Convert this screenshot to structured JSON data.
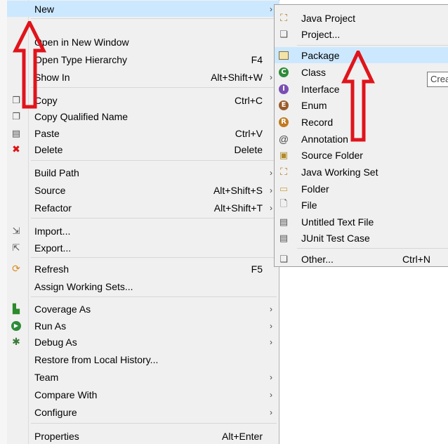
{
  "main_menu": {
    "items": [
      {
        "label": "New",
        "accel": "",
        "submenu": true,
        "selected": true,
        "icon": ""
      },
      {
        "label": "Open in New Window",
        "accel": "",
        "submenu": false,
        "icon": ""
      },
      {
        "label": "Open Type Hierarchy",
        "accel": "F4",
        "submenu": false,
        "icon": ""
      },
      {
        "label": "Show In",
        "accel": "Alt+Shift+W",
        "submenu": true,
        "icon": ""
      },
      {
        "label": "Copy",
        "accel": "Ctrl+C",
        "submenu": false,
        "icon": "copy-icon"
      },
      {
        "label": "Copy Qualified Name",
        "accel": "",
        "submenu": false,
        "icon": "copy-qualified-name-icon"
      },
      {
        "label": "Paste",
        "accel": "Ctrl+V",
        "submenu": false,
        "icon": "paste-icon"
      },
      {
        "label": "Delete",
        "accel": "Delete",
        "submenu": false,
        "icon": "delete-icon"
      },
      {
        "label": "Build Path",
        "accel": "",
        "submenu": true,
        "icon": ""
      },
      {
        "label": "Source",
        "accel": "Alt+Shift+S",
        "submenu": true,
        "icon": ""
      },
      {
        "label": "Refactor",
        "accel": "Alt+Shift+T",
        "submenu": true,
        "icon": ""
      },
      {
        "label": "Import...",
        "accel": "",
        "submenu": false,
        "icon": "import-icon"
      },
      {
        "label": "Export...",
        "accel": "",
        "submenu": false,
        "icon": "export-icon"
      },
      {
        "label": "Refresh",
        "accel": "F5",
        "submenu": false,
        "icon": "refresh-icon"
      },
      {
        "label": "Assign Working Sets...",
        "accel": "",
        "submenu": false,
        "icon": ""
      },
      {
        "label": "Coverage As",
        "accel": "",
        "submenu": true,
        "icon": "coverage-icon"
      },
      {
        "label": "Run As",
        "accel": "",
        "submenu": true,
        "icon": "run-icon"
      },
      {
        "label": "Debug As",
        "accel": "",
        "submenu": true,
        "icon": "debug-icon"
      },
      {
        "label": "Restore from Local History...",
        "accel": "",
        "submenu": false,
        "icon": ""
      },
      {
        "label": "Team",
        "accel": "",
        "submenu": true,
        "icon": ""
      },
      {
        "label": "Compare With",
        "accel": "",
        "submenu": true,
        "icon": ""
      },
      {
        "label": "Configure",
        "accel": "",
        "submenu": true,
        "icon": ""
      },
      {
        "label": "Properties",
        "accel": "Alt+Enter",
        "submenu": false,
        "icon": ""
      }
    ]
  },
  "submenu": {
    "items": [
      {
        "label": "Java Project",
        "accel": "",
        "icon": "java-project-icon"
      },
      {
        "label": "Project...",
        "accel": "",
        "icon": "project-icon"
      },
      {
        "label": "Package",
        "accel": "",
        "icon": "package-icon",
        "selected": true
      },
      {
        "label": "Class",
        "accel": "",
        "icon": "class-icon"
      },
      {
        "label": "Interface",
        "accel": "",
        "icon": "interface-icon"
      },
      {
        "label": "Enum",
        "accel": "",
        "icon": "enum-icon"
      },
      {
        "label": "Record",
        "accel": "",
        "icon": "record-icon"
      },
      {
        "label": "Annotation",
        "accel": "",
        "icon": "annotation-icon"
      },
      {
        "label": "Source Folder",
        "accel": "",
        "icon": "source-folder-icon"
      },
      {
        "label": "Java Working Set",
        "accel": "",
        "icon": "java-working-set-icon"
      },
      {
        "label": "Folder",
        "accel": "",
        "icon": "folder-icon"
      },
      {
        "label": "File",
        "accel": "",
        "icon": "file-icon"
      },
      {
        "label": "Untitled Text File",
        "accel": "",
        "icon": "untitled-text-file-icon"
      },
      {
        "label": "JUnit Test Case",
        "accel": "",
        "icon": "junit-test-case-icon"
      },
      {
        "label": "Other...",
        "accel": "Ctrl+N",
        "icon": "other-icon"
      }
    ]
  },
  "tooltip": {
    "text": "Crea"
  },
  "arrow_glyph": "›",
  "colors": {
    "selection": "#cce8ff",
    "annotation_arrow": "#e0141b",
    "menu_bg": "#f0f0f0"
  }
}
